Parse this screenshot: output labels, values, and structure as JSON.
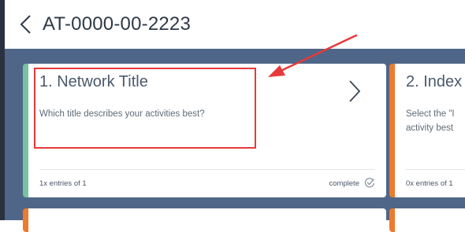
{
  "header": {
    "title": "AT-0000-00-2223",
    "back_icon": "chevron-left-icon"
  },
  "colors": {
    "background": "#4f6688",
    "card_complete_accent": "#78c2a2",
    "card_incomplete_accent": "#ee7a2d",
    "annotation": "#e63a3a"
  },
  "cards": [
    {
      "title": "1. Network Title",
      "description": "Which title describes your activities best?",
      "entries": "1x entries of 1",
      "status": "complete",
      "status_icon": "check-circle-icon",
      "nav_icon": "chevron-right-icon"
    },
    {
      "title": "2. Index",
      "description": "Select the \"I activity best",
      "entries": "0x entries of 1"
    }
  ]
}
